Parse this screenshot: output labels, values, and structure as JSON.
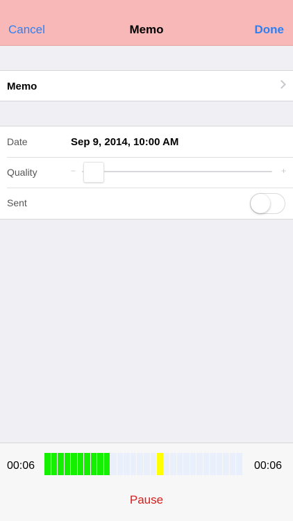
{
  "navbar": {
    "cancel_label": "Cancel",
    "title": "Memo",
    "done_label": "Done"
  },
  "memo_row": {
    "label": "Memo"
  },
  "form": {
    "date": {
      "label": "Date",
      "value": "Sep 9, 2014, 10:00 AM"
    },
    "quality": {
      "label": "Quality",
      "min_symbol": "−",
      "max_symbol": "+",
      "value": 0.0
    },
    "sent": {
      "label": "Sent",
      "on": false
    }
  },
  "recorder": {
    "elapsed": "00:06",
    "total": "00:06",
    "pause_label": "Pause",
    "level_meter": {
      "segments": 30,
      "active_segments": 10,
      "peak_segment": 17,
      "active_color": "#14f000",
      "peak_color": "#ffff00",
      "inactive_color": "#e9f0fb"
    }
  },
  "colors": {
    "navbar_bg": "#f8b8b8",
    "accent": "#2f7ff0",
    "pause": "#d81c1c",
    "background": "#efeff4"
  }
}
